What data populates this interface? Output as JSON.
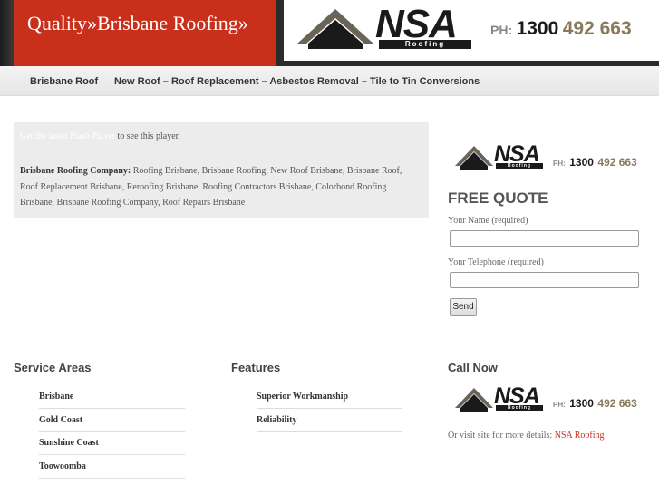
{
  "header": {
    "site_title": "Quality»Brisbane Roofing»",
    "logo": {
      "wordmark": "NSA",
      "bar_text": "Roofing"
    },
    "phone": {
      "prefix": "PH:",
      "part1": "1300",
      "part2": "492 663"
    }
  },
  "nav": {
    "items": [
      {
        "label": "Brisbane Roof"
      },
      {
        "label": "New Roof – Roof Replacement – Asbestos Removal – Tile to Tin Conversions"
      }
    ]
  },
  "content": {
    "flash_link": "Get the latest Flash Player",
    "flash_suffix": " to see this player.",
    "company_label": "Brisbane Roofing Company:",
    "company_text": " Roofing Brisbane, Brisbane Roofing, New Roof Brisbane, Brisbane Roof, Roof Replacement Brisbane, Reroofing Brisbane, Roofing Contractors Brisbane, Colorbond Roofing Brisbane, Brisbane Roofing Company, Roof Repairs Brisbane"
  },
  "sidebar": {
    "free_quote_title": "FREE QUOTE",
    "name_label": "Your Name (required)",
    "name_value": "",
    "phone_label": "Your Telephone (required)",
    "phone_value": "",
    "send_label": "Send"
  },
  "footer": {
    "service_areas": {
      "title": "Service Areas",
      "items": [
        "Brisbane",
        "Gold Coast",
        "Sunshine Coast",
        "Toowoomba"
      ]
    },
    "features": {
      "title": "Features",
      "items": [
        "Superior Workmanship",
        "Reliability"
      ]
    },
    "call_now": {
      "title": "Call Now",
      "visit_text": "Or visit site for more details: ",
      "visit_link": "NSA Roofing"
    }
  },
  "colors": {
    "brand_red": "#c8301b",
    "dark": "#2b2b2b",
    "phone_accent": "#8a7a5a"
  }
}
